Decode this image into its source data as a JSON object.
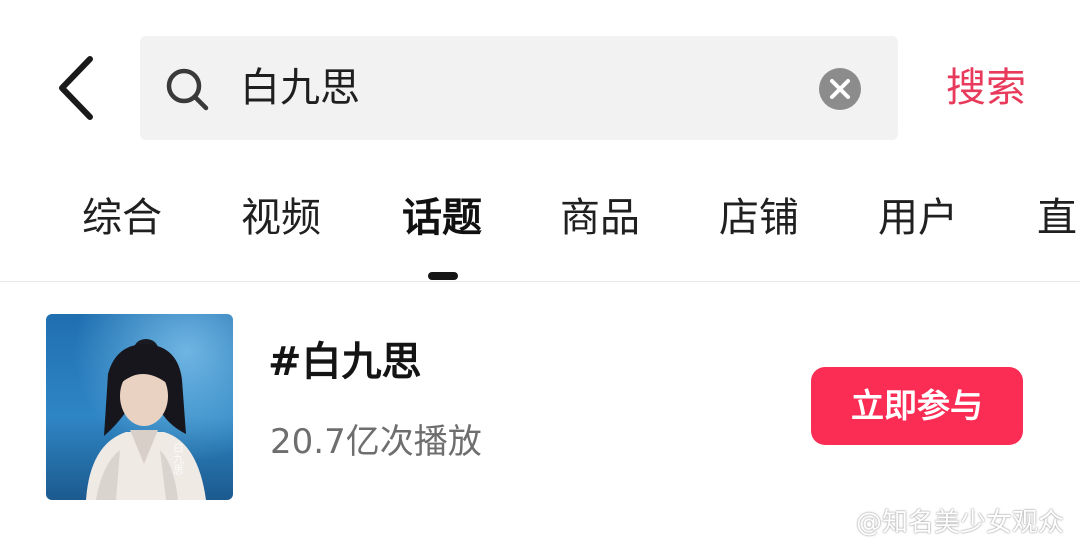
{
  "search": {
    "query": "白九思",
    "submit_label": "搜索"
  },
  "tabs": [
    {
      "label": "综合"
    },
    {
      "label": "视频"
    },
    {
      "label": "话题",
      "active": true
    },
    {
      "label": "商品"
    },
    {
      "label": "店铺"
    },
    {
      "label": "用户"
    },
    {
      "label": "直"
    }
  ],
  "result": {
    "title": "#白九思",
    "plays": "20.7亿次播放",
    "join_label": "立即参与"
  },
  "watermark": {
    "text": "@知名美少女观众"
  },
  "icons": {
    "back": "back-chevron-icon",
    "search": "search-icon",
    "clear": "clear-icon",
    "watermark": "weibo-logo-icon"
  },
  "colors": {
    "accent": "#e83a5b",
    "join_button": "#fb2d55",
    "search_bg": "#f2f2f2"
  }
}
